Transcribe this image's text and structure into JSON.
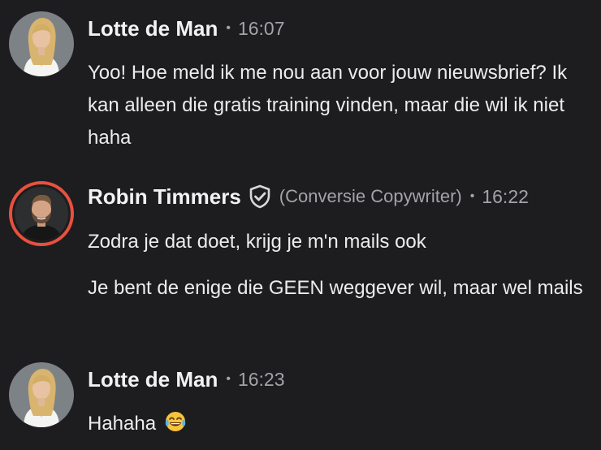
{
  "messages": [
    {
      "author": "Lotte de Man",
      "separator": "•",
      "time": "16:07",
      "lines": [
        "Yoo! Hoe meld ik me nou aan voor jouw nieuwsbrief? Ik kan alleen die gratis training vinden, maar die wil ik niet haha"
      ],
      "avatar_icon": "avatar-woman-blonde"
    },
    {
      "author": "Robin Timmers",
      "badge_icon": "verified-shield-check-icon",
      "role": "(Conversie Copywriter)",
      "separator": "•",
      "time": "16:22",
      "lines": [
        "Zodra je dat doet, krijg je m'n mails ook",
        "Je bent de enige die GEEN weggever wil, maar wel mails"
      ],
      "avatar_icon": "avatar-man-beard",
      "avatar_ring_color": "#e8513d"
    },
    {
      "author": "Lotte de Man",
      "separator": "•",
      "time": "16:23",
      "lines": [
        "Hahaha"
      ],
      "emoji": "😂",
      "avatar_icon": "avatar-woman-blonde"
    }
  ],
  "colors": {
    "background": "#1d1d1f",
    "name": "#f2f2f3",
    "meta": "#a3a3a8",
    "text": "#ececed",
    "ring": "#e8513d"
  }
}
